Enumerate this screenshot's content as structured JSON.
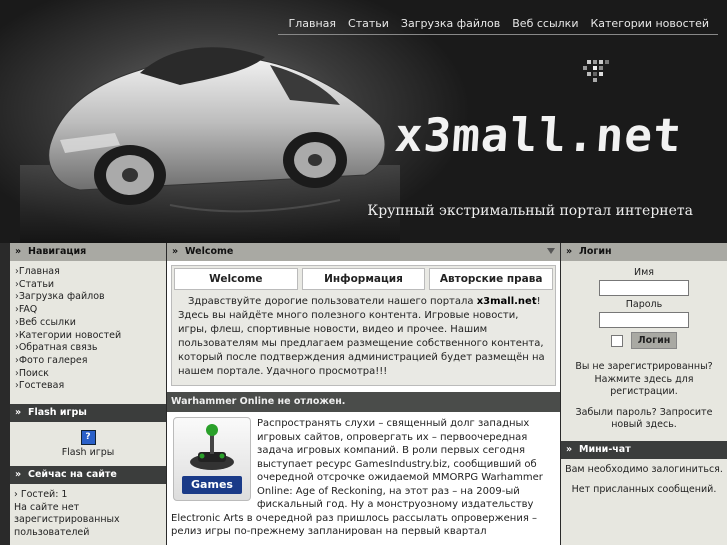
{
  "header": {
    "nav": [
      "Главная",
      "Статьи",
      "Загрузка файлов",
      "Веб ссылки",
      "Категории новостей"
    ],
    "site_name": "x3mall.net",
    "slogan": "Крупный экстримальный портал интернета"
  },
  "left": {
    "navigation": {
      "title": "Навигация",
      "items": [
        "Главная",
        "Статьи",
        "Загрузка файлов",
        "FAQ",
        "Веб ссылки",
        "Категории новостей",
        "Обратная связь",
        "Фото галерея",
        "Поиск",
        "Гостевая"
      ]
    },
    "flash": {
      "title": "Flash игры",
      "label": "Flash игры"
    },
    "online": {
      "title": "Сейчас на сайте",
      "guests": "Гостей: 1",
      "text": "На сайте нет зарегистрированных пользователей"
    }
  },
  "center": {
    "welcome": {
      "title": "Welcome",
      "tabs": [
        "Welcome",
        "Информация",
        "Авторские права"
      ],
      "text_before": "Здравствуйте дорогие пользователи нашего портала ",
      "text_bold": "x3mall.net",
      "text_after": "! Здесь вы найдёте много полезного контента. Игровые новости, игры, флеш, спортивные новости, видео и прочее. Нашим пользователям мы предлагаем размещение собственного контента, который после подтверждения администрацией будет размещён на нашем портале. Удачного просмотра!!!"
    },
    "news": {
      "title": "Warhammer Online не отложен.",
      "icon_label": "Games",
      "text": "Распространять слухи – священный долг западных игровых сайтов, опровергать их – первоочередная задача игровых компаний. В роли первых сегодня выступает ресурс GamesIndustry.biz, сообщивший об очередной отсрочке ожидаемой MMORPG Warhammer Online: Age of Reckoning, на этот раз – на 2009-ый фискальный год. Ну а монструозному издательству Electronic Arts в очередной раз пришлось рассылать опровержения – релиз игры по-прежнему запланирован на первый квартал"
    }
  },
  "right": {
    "login": {
      "title": "Логин",
      "name_label": "Имя",
      "password_label": "Пароль",
      "button": "Логин",
      "register": "Вы не зарегистрированны? Нажмите здесь для регистрации.",
      "forgot": "Забыли пароль? Запросите новый здесь."
    },
    "chat": {
      "title": "Мини-чат",
      "need_login": "Вам необходимо залогиниться.",
      "no_messages": "Нет присланных сообщений."
    }
  }
}
